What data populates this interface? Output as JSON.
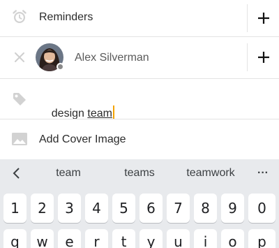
{
  "reminders": {
    "label": "Reminders",
    "add_label": "+"
  },
  "assignee": {
    "name": "Alex Silverman",
    "add_label": "+"
  },
  "tags": {
    "text_plain": "design ",
    "text_active": "team"
  },
  "cover": {
    "label": "Add Cover Image"
  },
  "keyboard": {
    "suggestions": [
      "team",
      "teams",
      "teamwork"
    ],
    "more_label": "···",
    "number_row": [
      "1",
      "2",
      "3",
      "4",
      "5",
      "6",
      "7",
      "8",
      "9",
      "0"
    ],
    "letter_row": [
      "q",
      "w",
      "e",
      "r",
      "t",
      "y",
      "u",
      "i",
      "o",
      "p"
    ]
  },
  "colors": {
    "cursor": "#f4a300",
    "icon_gray": "#c9c9c9",
    "keyboard_bg": "#e8eaed"
  }
}
